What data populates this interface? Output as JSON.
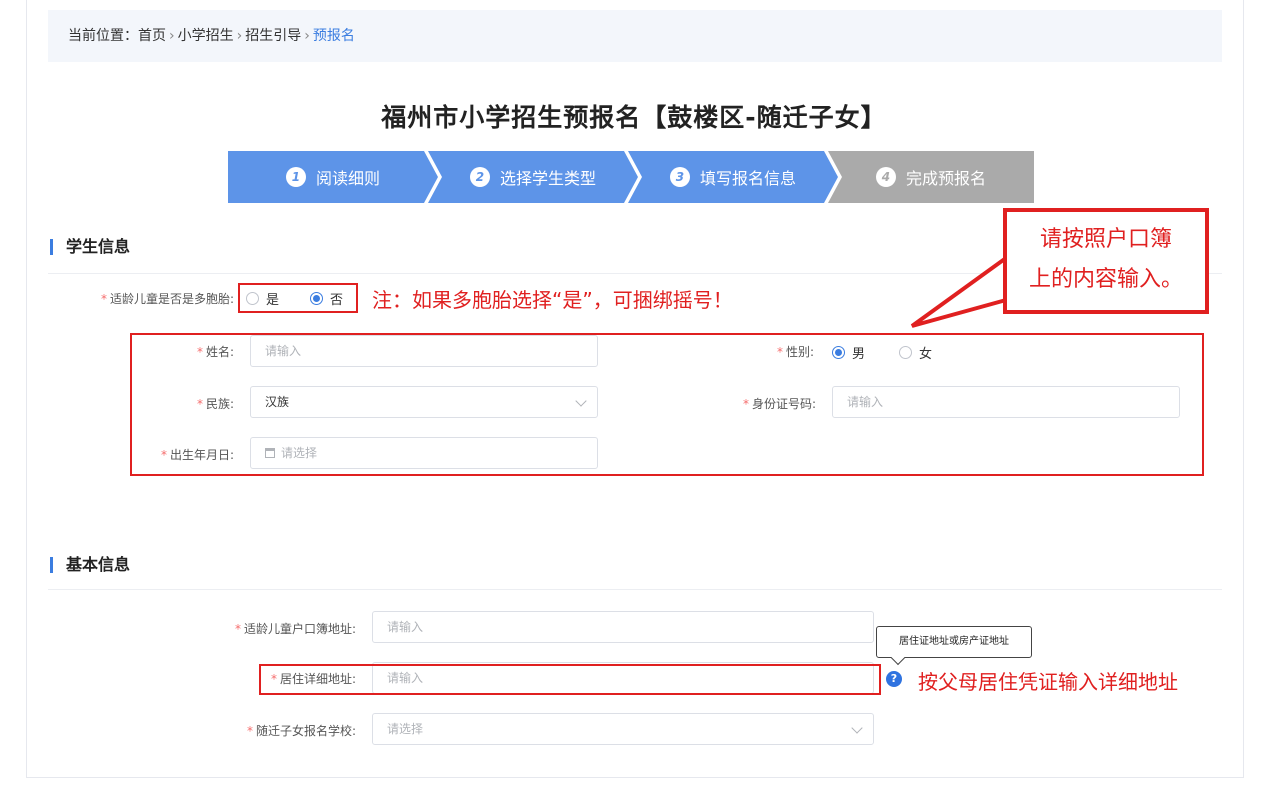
{
  "breadcrumb": {
    "prefix": "当前位置：",
    "items": [
      "首页",
      "小学招生",
      "招生引导"
    ],
    "current": "预报名",
    "separator": "›"
  },
  "title": "福州市小学招生预报名【鼓楼区-随迁子女】",
  "steps": [
    {
      "num": "1",
      "label": "阅读细则",
      "state": "done"
    },
    {
      "num": "2",
      "label": "选择学生类型",
      "state": "done"
    },
    {
      "num": "3",
      "label": "填写报名信息",
      "state": "active"
    },
    {
      "num": "4",
      "label": "完成预报名",
      "state": "pending"
    }
  ],
  "student_section": {
    "title": "学生信息",
    "multi_birth": {
      "label": "适龄儿童是否是多胞胎:",
      "options": [
        "是",
        "否"
      ],
      "selected": "否"
    },
    "multi_birth_note": "注：如果多胞胎选择“是”，可捆绑摇号！",
    "name": {
      "label": "姓名:",
      "placeholder": "请输入"
    },
    "gender": {
      "label": "性别:",
      "options": [
        "男",
        "女"
      ],
      "selected": "男"
    },
    "ethnicity": {
      "label": "民族:",
      "value": "汉族"
    },
    "id_number": {
      "label": "身份证号码:",
      "placeholder": "请输入"
    },
    "birthdate": {
      "label": "出生年月日:",
      "placeholder": "请选择"
    }
  },
  "callout_hukou": {
    "line1": "请按照户口簿",
    "line2": "上的内容输入。"
  },
  "basic_section": {
    "title": "基本信息",
    "hukou_address": {
      "label": "适龄儿童户口簿地址:",
      "placeholder": "请输入"
    },
    "residence_address": {
      "label": "居住详细地址:",
      "placeholder": "请输入"
    },
    "school": {
      "label": "随迁子女报名学校:",
      "placeholder": "请选择"
    },
    "tooltip": "居住证地址或房产证地址",
    "residence_note": "按父母居住凭证输入详细地址"
  },
  "colors": {
    "accent": "#3b7de0",
    "step_active": "#5d94e8",
    "step_pending": "#aaaaaa",
    "annotation": "#e02020"
  }
}
